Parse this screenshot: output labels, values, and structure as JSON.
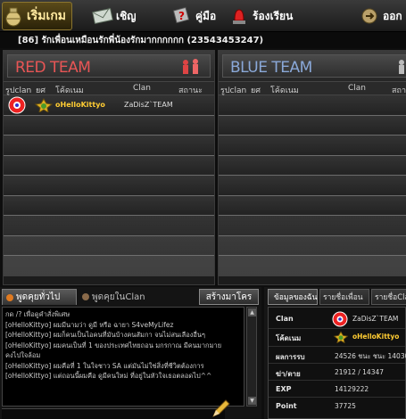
{
  "menu": {
    "start": "เริ่มเกม",
    "invite": "เชิญ",
    "manual": "คู่มือ",
    "complain": "ร้องเรียน",
    "exit": "ออก"
  },
  "room": {
    "title": "[86] รักเพื่อนเหมือนรักพี่น้องรักมากกกกกก (23543453247)"
  },
  "columns": {
    "clan_icon": "รูปclan",
    "rank": "ยศ",
    "codename": "โค้ดเนม",
    "clan": "Clan",
    "status": "สถานะ"
  },
  "red_team": {
    "title": "RED TEAM",
    "players": [
      {
        "name": "oHelloKittyo",
        "clan": "ZaDisZ`TEAM"
      }
    ]
  },
  "blue_team": {
    "title": "BLUE TEAM"
  },
  "chat": {
    "tab_general": "พูดคุยทั่วไป",
    "tab_clan": "พูดคุยในClan",
    "invite_button": "สร้างมาโคร",
    "lines": [
      "กด /? เพื่อดูคำสั่งพิเศษ",
      "[oHelloKittyo] ผมมีนามว่า ดูมี หรือ ฉายา S4veMyLifez",
      "[oHelloKittyo] ผมก็คนเป็นไอคนที่มันบ้างคนสัมกา จนไม่สนเลืองอื่นๆ",
      "[oHelloKittyo] ผมคนเป็นที่ 1 ของประเทศไทยถอน มกรกาณ มีคนมากมาย",
      "คงไปใจล้อม",
      "[oHelloKittyo] ผมคือที่ 1 ในใจชาว SA  แต่มันไม่ใช่สิ่งที่ชีวิตต้องการ",
      "[oHelloKittyo] แต่ถอนนี้ผมคือ ดูมีคนใหม่ ที่อยู่ในหัวใจเธอตลอดไป^^"
    ]
  },
  "info": {
    "tab_mine": "ข้อมูลของฉัน",
    "tab_friends": "รายชื่อเพื่อน",
    "tab_clan": "รายชื่อClan",
    "rows": [
      {
        "key": "Clan",
        "value": "ZaDisZ`TEAM"
      },
      {
        "key": "โค้ดเนม",
        "value": "oHelloKittyo"
      },
      {
        "key": "ผลการรบ",
        "value": "24526 ชนะ ชนะ 14030"
      },
      {
        "key": "ฆ่า/ตาย",
        "value": "21912 / 14347"
      },
      {
        "key": "EXP",
        "value": "14129222"
      },
      {
        "key": "Point",
        "value": "37725"
      }
    ]
  },
  "colors": {
    "red_team": "#e85555",
    "blue_team": "#8aa8d8",
    "player_name": "#ffcc33",
    "chat_tab_dot": "#e07a20"
  }
}
